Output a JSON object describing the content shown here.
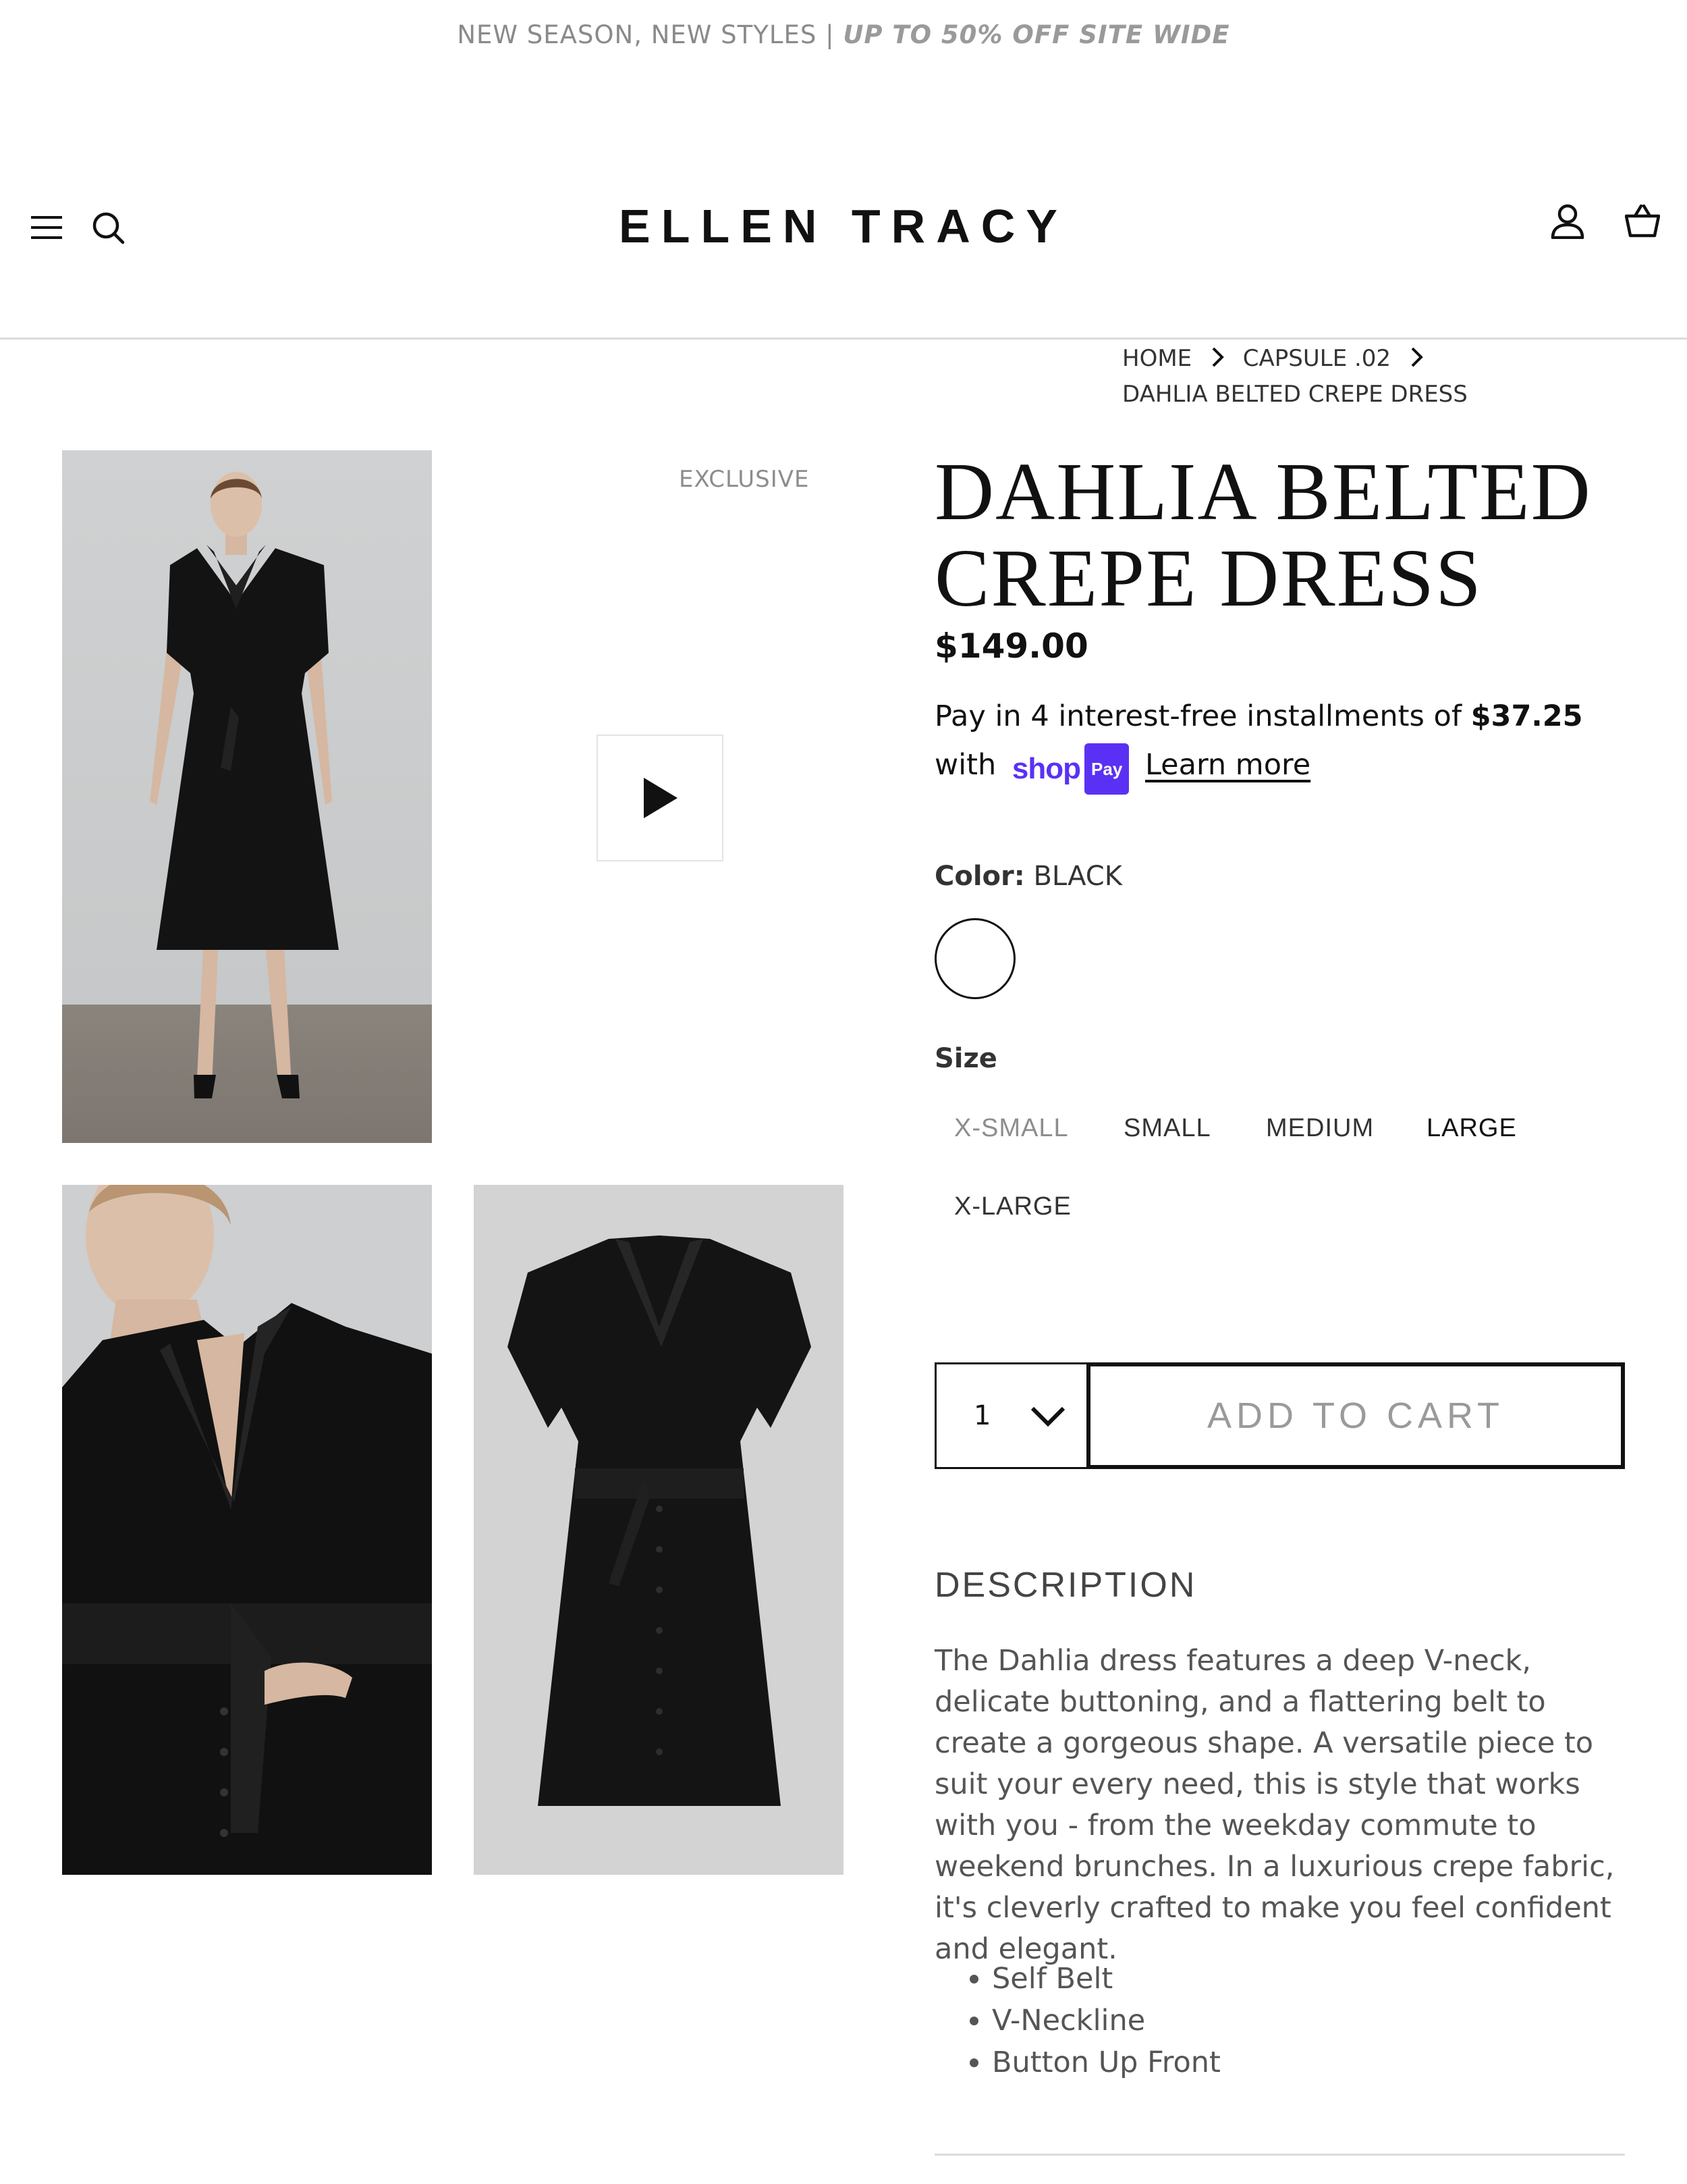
{
  "announcement": {
    "text": "NEW SEASON, NEW STYLES | ",
    "highlight": "UP TO 50% OFF SITE WIDE"
  },
  "header": {
    "brand": "ELLEN TRACY",
    "icons": [
      "menu-icon",
      "search-icon",
      "account-icon",
      "cart-icon"
    ]
  },
  "breadcrumb": {
    "home": "HOME",
    "collection": "CAPSULE .02",
    "current": "DAHLIA BELTED CREPE DRESS"
  },
  "gallery": {
    "badge": "EXCLUSIVE",
    "images": [
      "full-length model photo",
      "video thumbnail",
      "close-up model photo",
      "flat-lay dress photo"
    ]
  },
  "product": {
    "title": "DAHLIA BELTED CREPE DRESS",
    "price": "$149.00",
    "installments": {
      "prefix": "Pay in 4 interest-free installments of ",
      "amount": "$37.25",
      "with": "with",
      "shop_word": "shop",
      "pay_badge": "Pay",
      "learn_more": "Learn more"
    },
    "color": {
      "label": "Color:",
      "value": "BLACK"
    },
    "size": {
      "label": "Size",
      "options": [
        "X-SMALL",
        "SMALL",
        "MEDIUM",
        "LARGE",
        "X-LARGE"
      ],
      "unavailable": [
        "X-SMALL"
      ]
    },
    "quantity": "1",
    "add_to_cart": "ADD TO CART"
  },
  "description": {
    "heading": "DESCRIPTION",
    "body": "The Dahlia dress features a deep V-neck, delicate buttoning, and a flattering belt to create a gorgeous shape. A versatile piece to suit your every need, this is style that works with you - from the weekday commute to weekend brunches. In a luxurious crepe fabric, it's cleverly crafted to make you feel confident and elegant.",
    "features": [
      "Self Belt",
      "V-Neckline",
      "Button Up Front"
    ]
  },
  "colors": {
    "shop_pay": "#5a31f4",
    "text": "#111111",
    "muted": "#8d8d8d"
  }
}
